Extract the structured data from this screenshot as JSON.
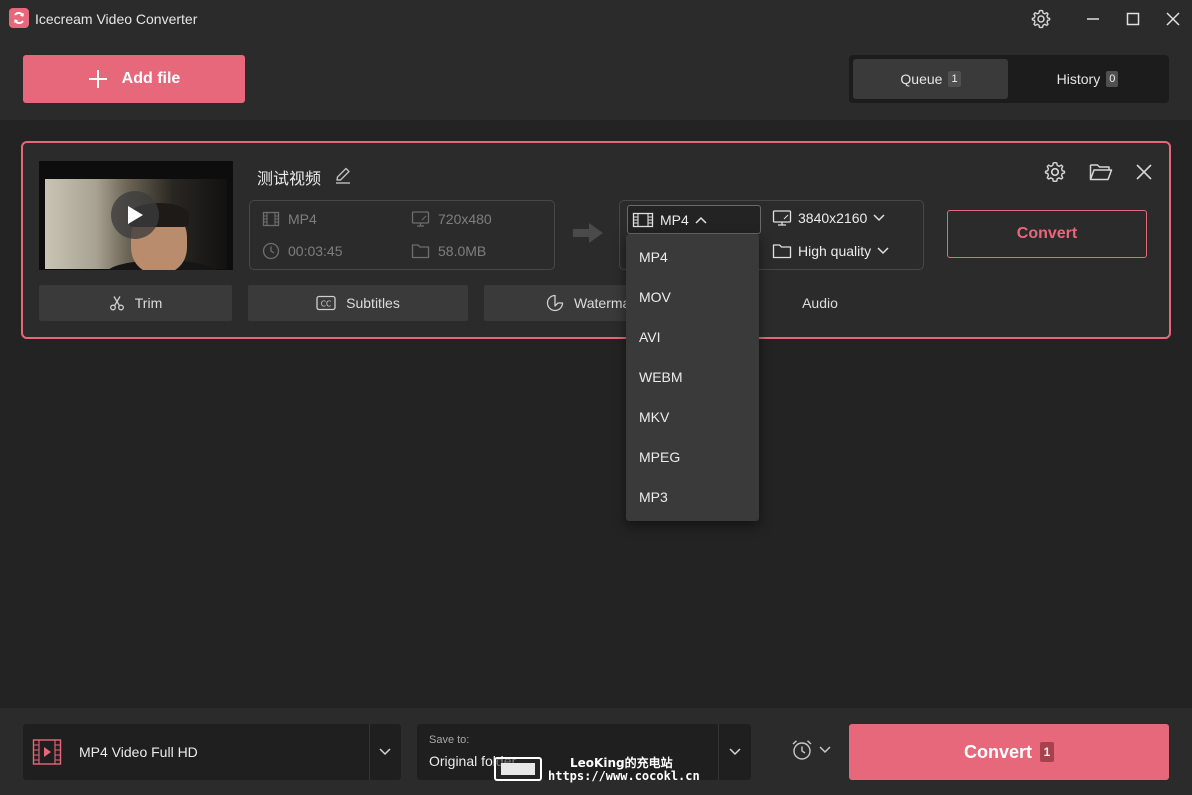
{
  "window": {
    "title": "Icecream Video Converter"
  },
  "toolbar": {
    "add_file_label": "Add file",
    "tabs": [
      {
        "label": "Queue",
        "count": "1",
        "active": true
      },
      {
        "label": "History",
        "count": "0",
        "active": false
      }
    ]
  },
  "file_item": {
    "name": "测试视频",
    "source": {
      "format": "MP4",
      "resolution": "720x480",
      "duration": "00:03:45",
      "size": "58.0MB"
    },
    "target": {
      "format": "MP4",
      "resolution": "3840x2160",
      "quality": "High quality"
    },
    "convert_label": "Convert",
    "tools": {
      "trim": "Trim",
      "subtitles": "Subtitles",
      "watermark": "Watermark",
      "audio": "Audio"
    }
  },
  "format_dropdown": {
    "options": [
      "MP4",
      "MOV",
      "AVI",
      "WEBM",
      "MKV",
      "MPEG",
      "MP3"
    ]
  },
  "bottom": {
    "preset_label": "MP4 Video Full HD",
    "save_to_label": "Save to:",
    "save_to_value": "Original folder",
    "convert_label": "Convert",
    "convert_count": "1"
  },
  "overlay_watermark": {
    "line1": "LeoKing的充电站",
    "line2": "https://www.cocokl.cn"
  },
  "colors": {
    "accent": "#e8687b",
    "background": "#232323",
    "panel": "#2b2b2b"
  }
}
